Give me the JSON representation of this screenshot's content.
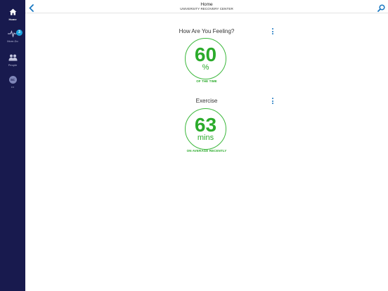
{
  "sidebar": {
    "items": [
      {
        "label": "Home",
        "icon": "home-icon",
        "active": true
      },
      {
        "label": "More-Do",
        "icon": "pulse-icon",
        "badge": "3"
      },
      {
        "label": "People",
        "icon": "people-icon"
      },
      {
        "label": "•••",
        "icon": "avatar",
        "avatar_text": "SC"
      }
    ]
  },
  "header": {
    "title": "Home",
    "subtitle": "UNIVERSITY RECOVERY CENTER"
  },
  "cards": [
    {
      "title": "How Are You Feeling?",
      "value": "60",
      "unit": "%",
      "caption": "OF THE TIME"
    },
    {
      "title": "Exercise",
      "value": "63",
      "unit": "mins",
      "caption": "ON AVERAGE RECENTLY"
    }
  ],
  "colors": {
    "sidebar": "#181a4e",
    "accent_green": "#2bab2b",
    "accent_blue": "#1a78c2",
    "badge": "#1aa3de"
  }
}
